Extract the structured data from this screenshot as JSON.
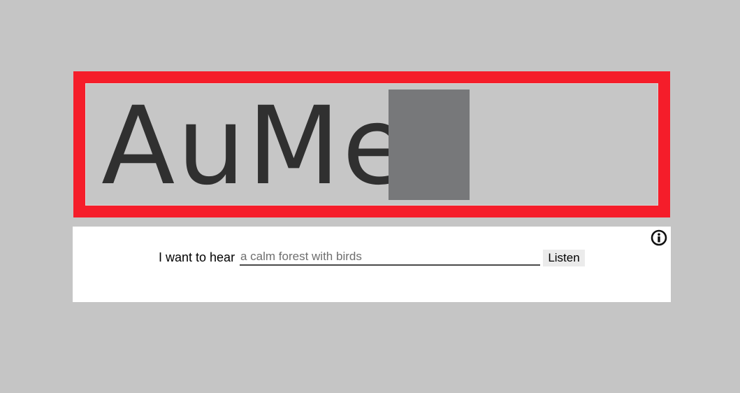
{
  "logo": {
    "text": "AuMe",
    "cursor_color": "#77787a",
    "border_color": "#f51d2a"
  },
  "prompt": {
    "label": "I want to hear",
    "query_value": "",
    "query_placeholder": "a calm forest with birds",
    "listen_label": "Listen"
  },
  "icons": {
    "info": "info-icon"
  }
}
